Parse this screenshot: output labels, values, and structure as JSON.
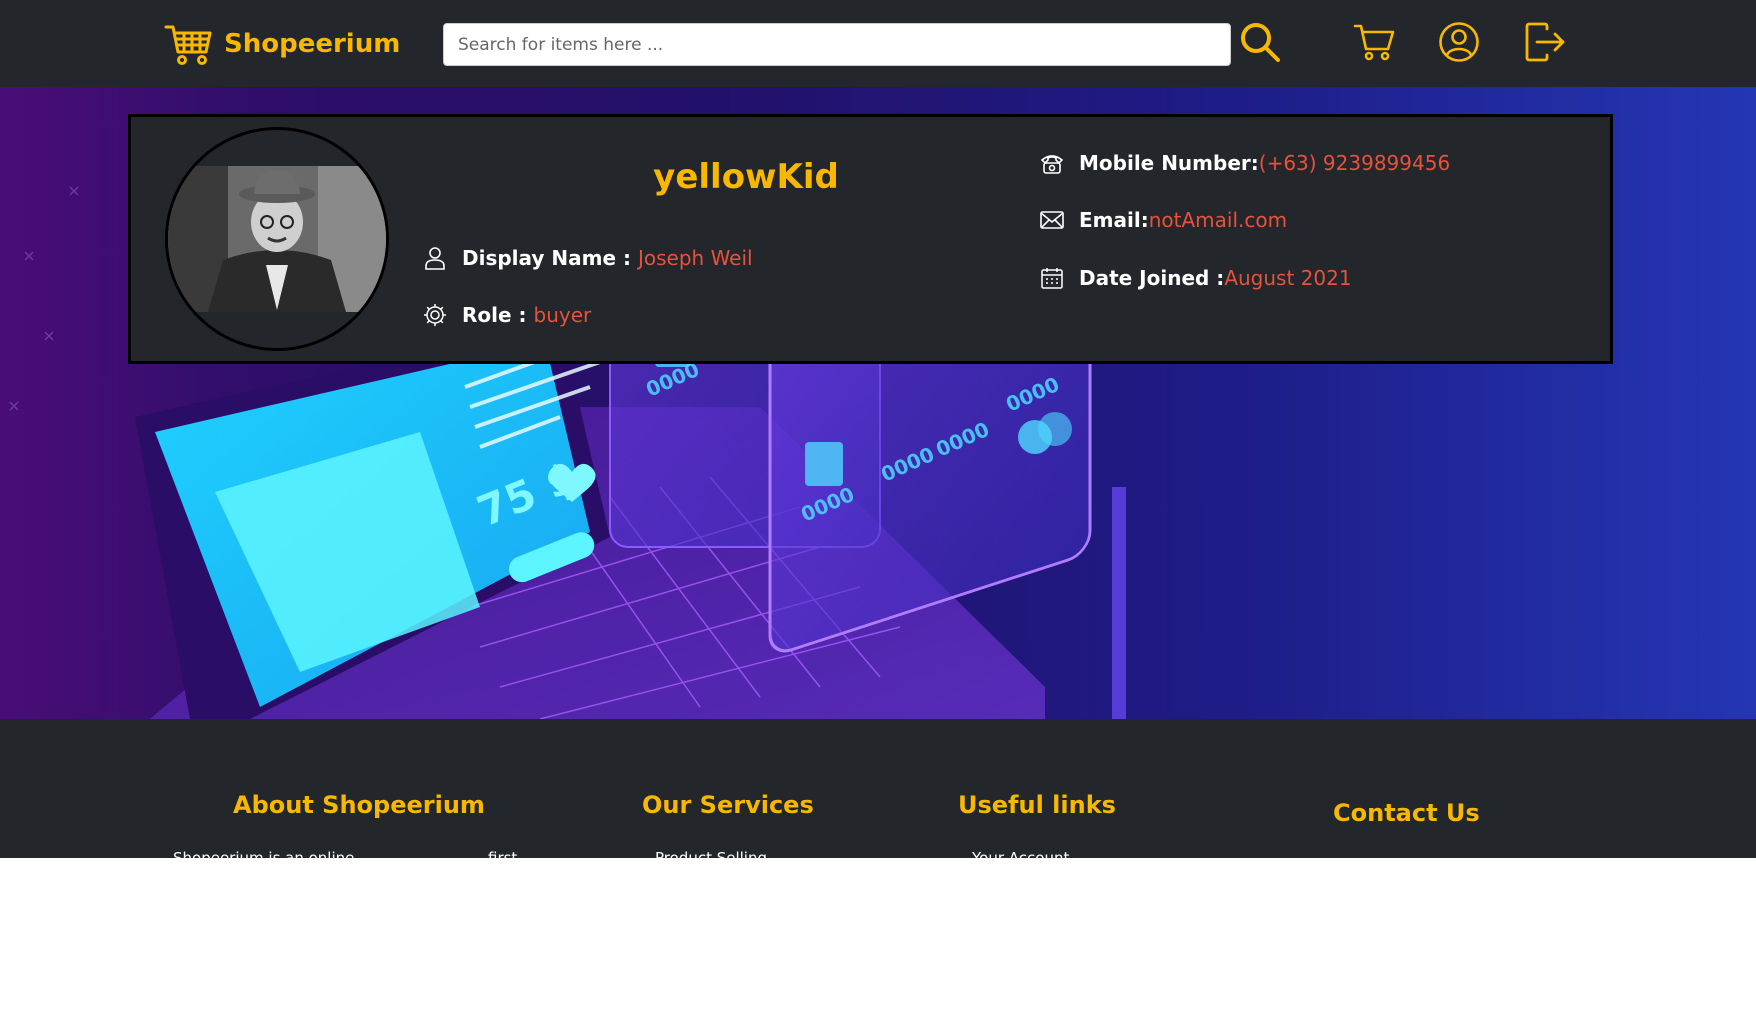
{
  "brand": {
    "name": "Shopeerium",
    "icon": "shopping-basket-icon"
  },
  "search": {
    "placeholder": "Search for items here ..."
  },
  "nav_icons": [
    "search-icon",
    "cart-icon",
    "user-circle-icon",
    "logout-icon"
  ],
  "profile": {
    "username": "yellowKid",
    "display_name_label": "Display Name : ",
    "display_name": "Joseph Weil",
    "role_label": "Role : ",
    "role": "buyer",
    "mobile_label": "Mobile Number: ",
    "mobile": "(+63) 9239899456",
    "email_label": "Email: ",
    "email": "notAmail.com",
    "date_label": "Date Joined : ",
    "date_joined": "August 2021"
  },
  "footer": {
    "about_title": "About Shopeerium",
    "about_text": "Shopeerium is an online",
    "about_text_2": "first",
    "services_title": "Our Services",
    "services_text": "Product Selling",
    "links_title": "Useful links",
    "links_text": "Your Account",
    "contact_title": "Contact Us"
  },
  "colors": {
    "accent": "#f8b800",
    "value": "#e8523a",
    "dark": "#23262b"
  }
}
